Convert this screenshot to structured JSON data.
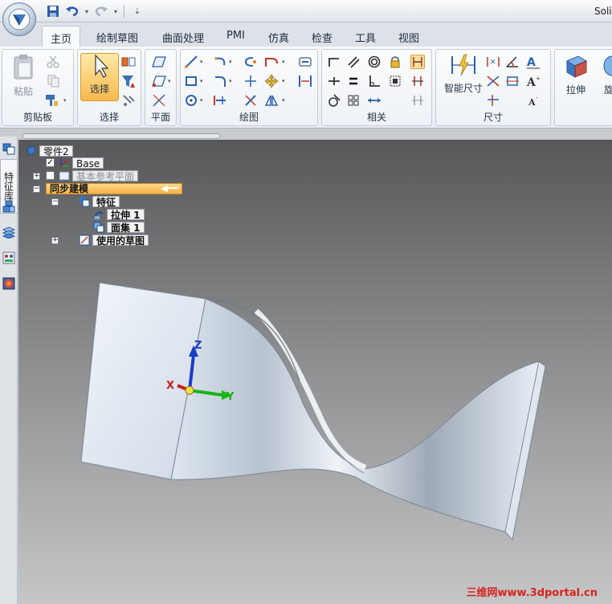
{
  "window": {
    "title": "Soli"
  },
  "tabs": [
    {
      "label": "主页",
      "active": true
    },
    {
      "label": "绘制草图"
    },
    {
      "label": "曲面处理"
    },
    {
      "label": "PMI"
    },
    {
      "label": "仿真"
    },
    {
      "label": "检查"
    },
    {
      "label": "工具"
    },
    {
      "label": "视图"
    }
  ],
  "ribbon": {
    "groups": {
      "clipboard": {
        "label": "剪贴板",
        "paste": "粘贴"
      },
      "select": {
        "label": "选择",
        "select": "选择"
      },
      "plane": {
        "label": "平面"
      },
      "draw": {
        "label": "绘图"
      },
      "relate": {
        "label": "相关"
      },
      "dimension": {
        "label": "尺寸",
        "smart_dimension": "智能尺寸"
      },
      "solid": {
        "extrude": "拉伸",
        "revolve": "旋"
      }
    }
  },
  "sidebar": {
    "tab_label": "特征库"
  },
  "tree": {
    "part": "零件2",
    "base": "Base",
    "ref_planes": "基本参考平面",
    "sync": "同步建模",
    "features": "特征",
    "extrude": "拉伸 1",
    "face_set": "面集 1",
    "used_sketch": "使用的草图"
  },
  "axes": {
    "x": "X",
    "y": "Y",
    "z": "Z"
  },
  "watermark": "三维网www.3dportal.cn",
  "colors": {
    "accent": "#f6b146",
    "ribbon_bg": "#eef2f6",
    "viewport_top": "#565759",
    "viewport_bottom": "#c5c6c8"
  }
}
